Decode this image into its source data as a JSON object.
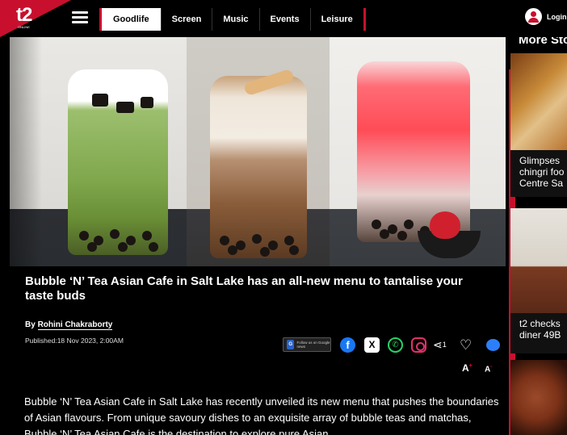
{
  "header": {
    "logo_text": "t2",
    "logo_sub": "ONLINE",
    "nav": [
      "Goodlife",
      "Screen",
      "Music",
      "Events",
      "Leisure"
    ],
    "nav_active": "Goodlife",
    "login_label": "Login"
  },
  "article": {
    "title": "Bubble ‘N’ Tea Asian Cafe in Salt Lake has an all-new menu to tantalise your taste buds",
    "by_prefix": "By",
    "author": "Rohini Chakraborty",
    "published": "Published:18 Nov 2023, 2:00AM",
    "google_news_badge": "G",
    "google_news_text": "Follow us on Google news",
    "share_count": "1",
    "font_increase": "A",
    "font_decrease": "A",
    "body": "Bubble ‘N’ Tea Asian Cafe in Salt Lake has recently unveiled its new menu that pushes the boundaries of Asian flavours. From unique savoury dishes to an exquisite array of bubble teas and matchas, Bubble ‘N’ Tea Asian Cafe is the destination to explore pure Asian"
  },
  "sidebar": {
    "heading": "More Sto",
    "cards": [
      {
        "title_lines": [
          "Glimpses",
          "chingri foo",
          "Centre Sa"
        ]
      },
      {
        "title_lines": [
          "t2 checks",
          "diner 49B"
        ]
      },
      {
        "title_lines": []
      }
    ]
  },
  "icons": {
    "menu": "hamburger-icon",
    "user": "user-icon",
    "facebook": "facebook-icon",
    "x": "x-icon",
    "whatsapp": "whatsapp-icon",
    "instagram": "instagram-icon",
    "share": "share-icon",
    "heart": "heart-icon",
    "comment": "comment-icon"
  },
  "colors": {
    "brand_red": "#c8102e",
    "background": "#000000",
    "facebook": "#1877f2",
    "whatsapp": "#25d366",
    "instagram": "#e1306c"
  }
}
